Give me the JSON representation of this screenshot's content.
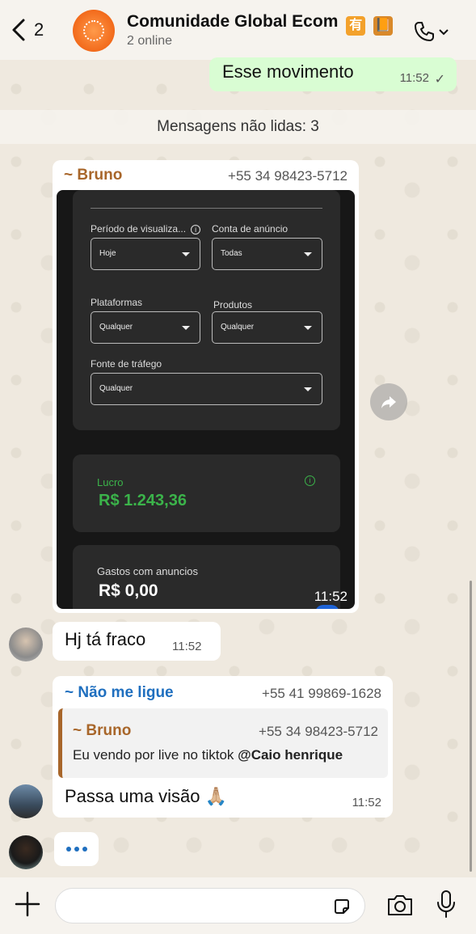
{
  "header": {
    "back_count": "2",
    "title": "Comunidade Global Ecom",
    "emoji_1": "有",
    "emoji_2": "📙",
    "subtitle": "2 online"
  },
  "outgoing": {
    "text": "Esse movimento",
    "time": "11:52"
  },
  "unread_banner": "Mensagens não lidas: 3",
  "image_message": {
    "sender": "~ Bruno",
    "phone": "+55 34 98423-5712",
    "time": "11:52",
    "screenshot": {
      "periodo_label": "Período de visualiza...",
      "periodo_value": "Hoje",
      "conta_label": "Conta de anúncio",
      "conta_value": "Todas",
      "plataformas_label": "Plataformas",
      "plataformas_value": "Qualquer",
      "produtos_label": "Produtos",
      "produtos_value": "Qualquer",
      "fonte_label": "Fonte de tráfego",
      "fonte_value": "Qualquer",
      "lucro_label": "Lucro",
      "lucro_value": "R$ 1.243,36",
      "gastos_label": "Gastos com anuncios",
      "gastos_value": "R$ 0,00"
    }
  },
  "message_1": {
    "text": "Hj tá fraco",
    "time": "11:52"
  },
  "message_2": {
    "sender": "~ Não me ligue",
    "phone": "+55 41 99869-1628",
    "quote_sender": "~ Bruno",
    "quote_phone": "+55 34 98423-5712",
    "quote_text": "Eu vendo por live no tiktok ",
    "quote_mention": "@Caio henrique",
    "text": "Passa uma visão 🙏🏼",
    "time": "11:52"
  },
  "colors": {
    "outgoing_bubble": "#d9fdd3",
    "bruno_name": "#a8662a",
    "nao_me_ligue_name": "#1f6fbf",
    "lucro_green": "#3bb34a"
  },
  "icons": [
    "back-chevron-icon",
    "phone-icon",
    "chevron-down-icon",
    "forward-icon",
    "plus-icon",
    "sticker-icon",
    "camera-icon",
    "mic-icon",
    "info-icon"
  ]
}
